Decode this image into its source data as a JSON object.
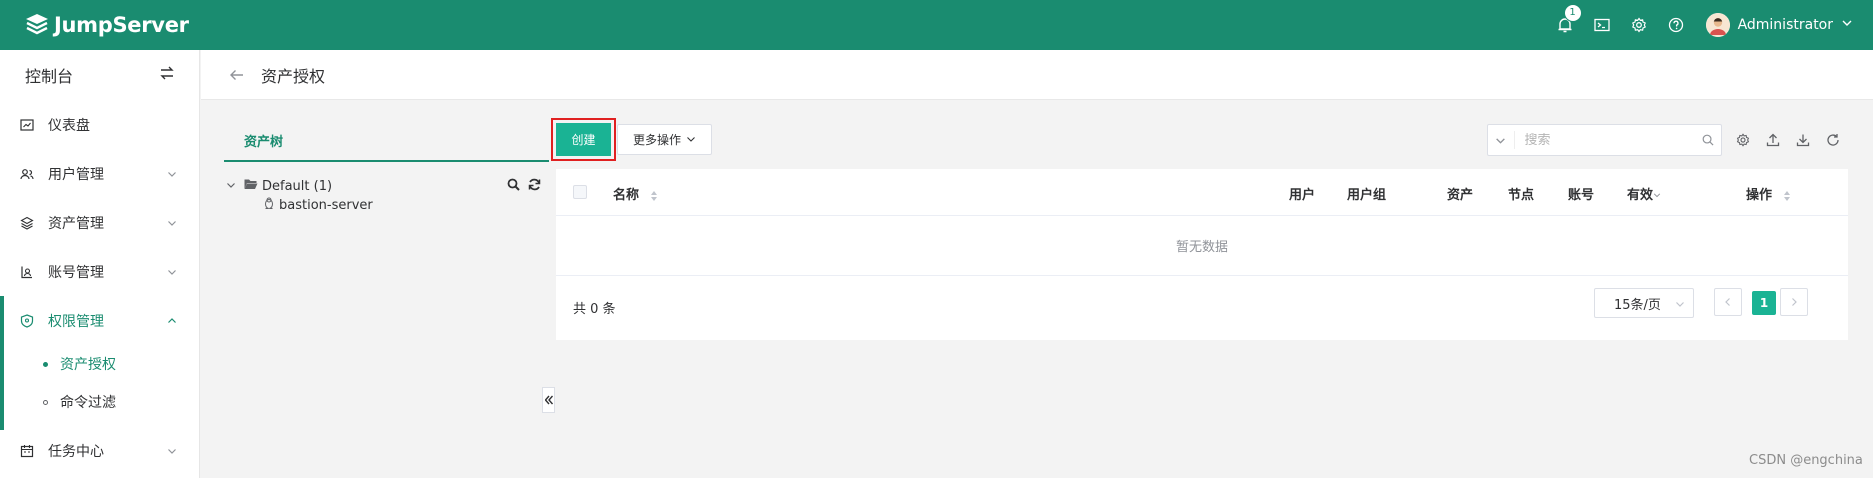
{
  "app": {
    "name": "JumpServer"
  },
  "topbar": {
    "notification_count": "1",
    "user_name": "Administrator",
    "icons": [
      "bell-icon",
      "terminal-icon",
      "gear-icon",
      "help-icon"
    ]
  },
  "sidebar": {
    "title": "控制台",
    "items": [
      {
        "label": "仪表盘",
        "icon": "dashboard-icon"
      },
      {
        "label": "用户管理",
        "icon": "users-icon"
      },
      {
        "label": "资产管理",
        "icon": "layers-icon"
      },
      {
        "label": "账号管理",
        "icon": "account-icon"
      },
      {
        "label": "权限管理",
        "icon": "shield-icon"
      },
      {
        "label": "任务中心",
        "icon": "calendar-icon"
      }
    ],
    "subitems": [
      {
        "label": "资产授权"
      },
      {
        "label": "命令过滤"
      }
    ]
  },
  "page": {
    "title": "资产授权"
  },
  "tree": {
    "tab_label": "资产树",
    "root_label": "Default (1)",
    "child_label": "bastion-server"
  },
  "toolbar": {
    "create_label": "创建",
    "more_label": "更多操作",
    "search_placeholder": "搜索"
  },
  "table": {
    "columns": {
      "name": "名称",
      "user": "用户",
      "user_group": "用户组",
      "asset": "资产",
      "node": "节点",
      "account": "账号",
      "valid": "有效",
      "action": "操作"
    },
    "empty_text": "暂无数据",
    "total_text": "共 0 条",
    "page_size": "15条/页",
    "current_page": "1"
  },
  "watermark": "CSDN @engchina",
  "colors": {
    "brand": "#1a8c70",
    "primary_button": "#1ab394",
    "highlight_border": "#e02020"
  }
}
